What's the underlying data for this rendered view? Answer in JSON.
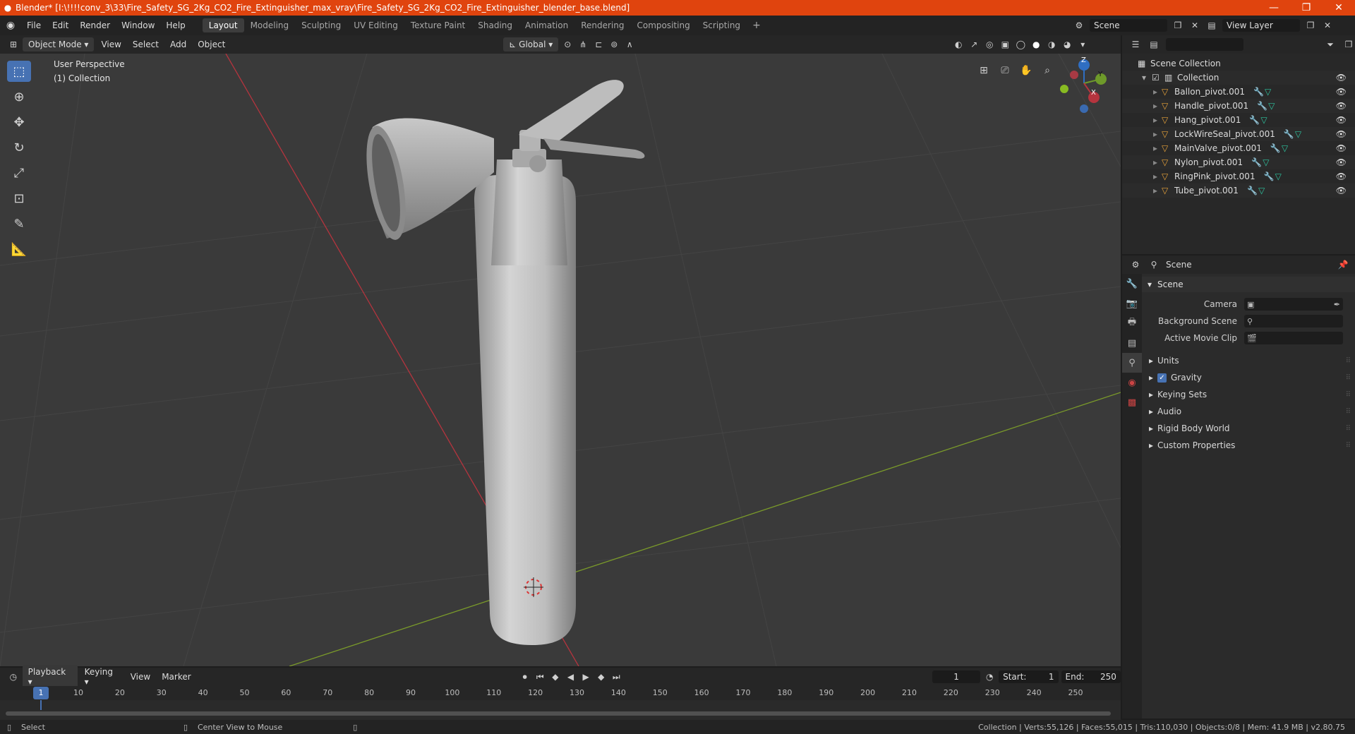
{
  "window": {
    "title": "Blender* [I:\\!!!!conv_3\\33\\Fire_Safety_SG_2Kg_CO2_Fire_Extinguisher_max_vray\\Fire_Safety_SG_2Kg_CO2_Fire_Extinguisher_blender_base.blend]",
    "minimize": "—",
    "maximize": "❐",
    "close": "✕"
  },
  "menu": [
    "File",
    "Edit",
    "Render",
    "Window",
    "Help"
  ],
  "workspaces": [
    "Layout",
    "Modeling",
    "Sculpting",
    "UV Editing",
    "Texture Paint",
    "Shading",
    "Animation",
    "Rendering",
    "Compositing",
    "Scripting"
  ],
  "active_workspace": "Layout",
  "scene_selector": {
    "scene": "Scene",
    "view_layer": "View Layer"
  },
  "viewport_header": {
    "mode": "Object Mode",
    "items": [
      "View",
      "Select",
      "Add",
      "Object"
    ],
    "transform_orientation": "Global"
  },
  "viewport": {
    "view_name": "User Perspective",
    "collection": "(1) Collection",
    "axes": {
      "x": "X",
      "y": "Y",
      "z": "Z"
    },
    "colors": {
      "background": "#3a3a3a",
      "x_axis": "#b5343e",
      "y_axis": "#7a9a2a",
      "grid": "#454545"
    }
  },
  "outliner": {
    "search_placeholder": "",
    "root": "Scene Collection",
    "collection": "Collection",
    "objects": [
      "Ballon_pivot.001",
      "Handle_pivot.001",
      "Hang_pivot.001",
      "LockWireSeal_pivot.001",
      "MainValve_pivot.001",
      "Nylon_pivot.001",
      "RingPink_pivot.001",
      "Tube_pivot.001"
    ]
  },
  "properties": {
    "header": "Scene",
    "panel": "Scene",
    "rows": [
      {
        "label": "Camera",
        "value": ""
      },
      {
        "label": "Background Scene",
        "value": ""
      },
      {
        "label": "Active Movie Clip",
        "value": ""
      }
    ],
    "subpanels": [
      "Units",
      "Gravity",
      "Keying Sets",
      "Audio",
      "Rigid Body World",
      "Custom Properties"
    ]
  },
  "timeline": {
    "menus": [
      "Playback",
      "Keying",
      "View",
      "Marker"
    ],
    "current_frame": "1",
    "start_label": "Start:",
    "start": "1",
    "end_label": "End:",
    "end": "250",
    "ticks": [
      "10",
      "20",
      "30",
      "40",
      "50",
      "60",
      "70",
      "80",
      "90",
      "100",
      "110",
      "120",
      "130",
      "140",
      "150",
      "160",
      "170",
      "180",
      "190",
      "200",
      "210",
      "220",
      "230",
      "240",
      "250"
    ]
  },
  "statusbar": {
    "left": "Select",
    "middle": "Center View to Mouse",
    "right": "Collection | Verts:55,126 | Faces:55,015 | Tris:110,030 | Objects:0/8 | Mem: 41.9 MB | v2.80.75"
  }
}
